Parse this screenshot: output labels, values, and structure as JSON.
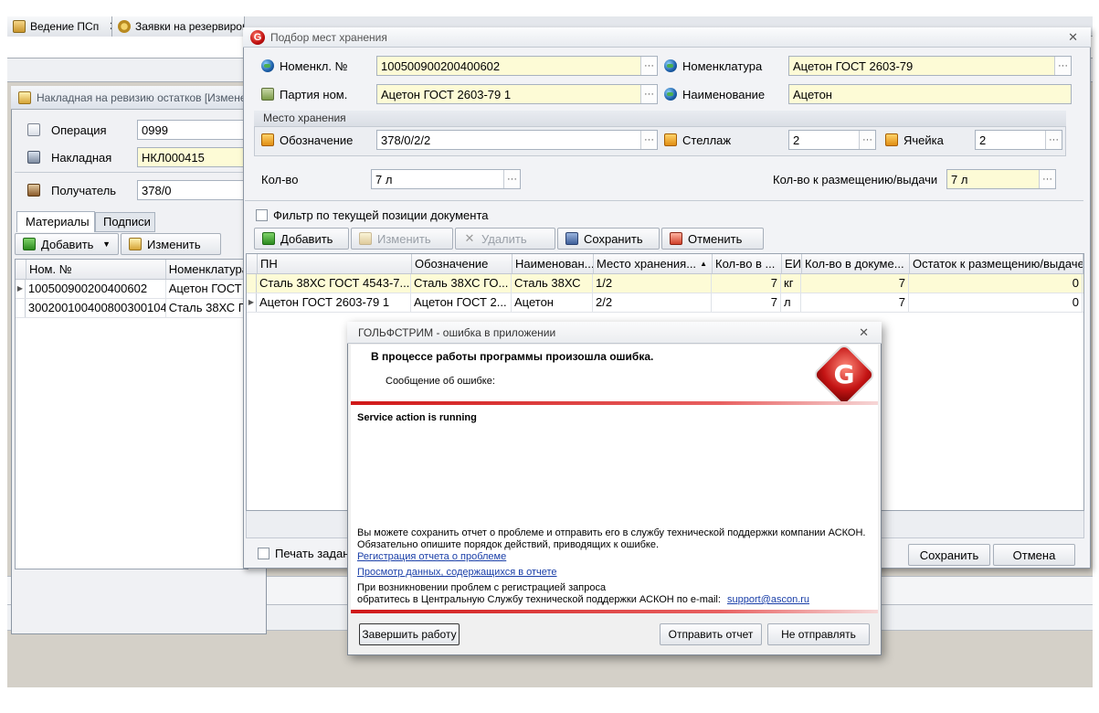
{
  "app_tabs": [
    {
      "label": "Ведение ПСп",
      "close": "✕"
    },
    {
      "label": "Заявки на резервирова"
    }
  ],
  "doc_window": {
    "title": "Накладная на ревизию остатков [Измене",
    "operation_label": "Операция",
    "operation_value": "0999",
    "invoice_label": "Накладная",
    "invoice_value": "НКЛ000415",
    "receiver_label": "Получатель",
    "receiver_value": "378/0",
    "tabs": [
      "Материалы",
      "Подписи"
    ],
    "add_label": "Добавить",
    "edit_label": "Изменить",
    "columns": [
      "Ном. №",
      "Номенклатура"
    ],
    "rows": [
      [
        "100500900200400602",
        "Ацетон ГОСТ"
      ],
      [
        "300200100400800300104",
        "Сталь 38ХС Г"
      ]
    ]
  },
  "dialog": {
    "title": "Подбор мест хранения",
    "close": "✕",
    "nom_num_label": "Номенкл. №",
    "nom_num_value": "100500900200400602",
    "nomenclature_label": "Номенклатура",
    "nomenclature_value": "Ацетон ГОСТ 2603-79",
    "batch_label": "Партия ном.",
    "batch_value": "Ацетон ГОСТ 2603-79 1",
    "name_label": "Наименование",
    "name_value": "Ацетон",
    "storage_group": "Место хранения",
    "designation_label": "Обозначение",
    "designation_value": "378/0/2/2",
    "rack_label": "Стеллаж",
    "rack_value": "2",
    "cell_label": "Ячейка",
    "cell_value": "2",
    "qty_label": "Кол-во",
    "qty_value": "7 л",
    "qty_place_label": "Кол-во к размещению/выдачи",
    "qty_place_value": "7 л",
    "filter_label": "Фильтр по текущей позиции документа",
    "toolbar": {
      "add": "Добавить",
      "edit": "Изменить",
      "delete": "Удалить",
      "save": "Сохранить",
      "cancel": "Отменить"
    },
    "columns": [
      "ПН",
      "Обозначение",
      "Наименован...",
      "Место хранения...",
      "Кол-во в ...",
      "ЕИ",
      "Кол-во в докуме...",
      "Остаток к размещению/выдаче"
    ],
    "rows": [
      [
        "Сталь 38ХС ГОСТ 4543-7...",
        "Сталь 38ХС ГО...",
        "Сталь 38ХС",
        "1/2",
        "7",
        "кг",
        "7",
        "0"
      ],
      [
        "Ацетон ГОСТ 2603-79 1",
        "Ацетон ГОСТ 2...",
        "Ацетон",
        "2/2",
        "7",
        "л",
        "7",
        "0"
      ]
    ],
    "print_label": "Печать задан",
    "save_button": "Сохранить",
    "cancel_button": "Отмена"
  },
  "error_dialog": {
    "title": "ГОЛЬФСТРИМ - ошибка в приложении",
    "close": "✕",
    "heading": "В процессе работы программы произошла ошибка.",
    "message_label": "Сообщение об ошибке:",
    "message": "Service action is running",
    "info1": "Вы можете сохранить отчет о проблеме и отправить его в службу технической поддержки компании АСКОН.",
    "info2": "Обязательно опишите порядок действий, приводящих к ошибке.",
    "link_register": "Регистрация отчета о проблеме",
    "link_view": "Просмотр данных, содержащихся в отчете",
    "contact1": "При возникновении проблем с регистрацией запроса",
    "contact2": "обратитесь в Центральную Службу технической поддержки АСКОН по e-mail:",
    "email": "support@ascon.ru",
    "btn_finish": "Завершить работу",
    "btn_send": "Отправить отчет",
    "btn_nosend": "Не отправлять",
    "logo_letter": "G"
  }
}
